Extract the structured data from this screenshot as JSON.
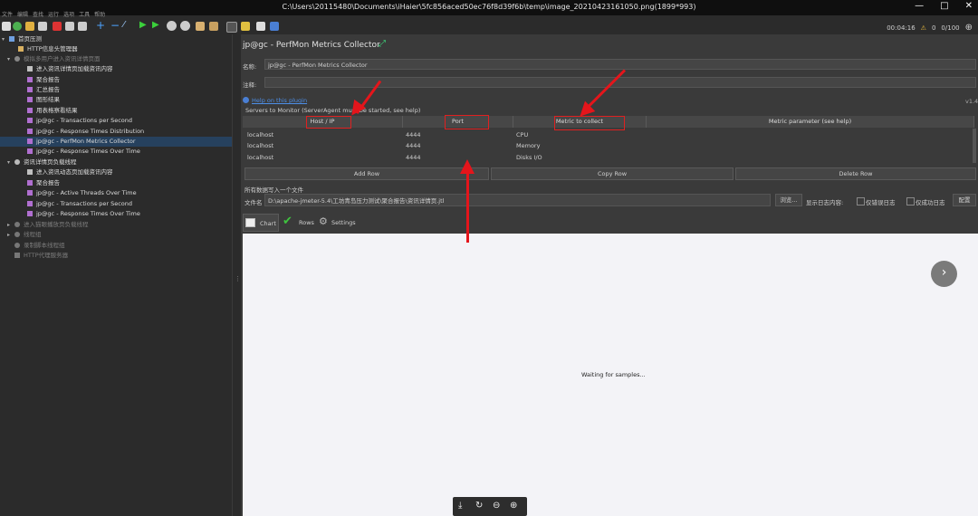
{
  "window": {
    "title": "C:\\Users\\20115480\\Documents\\iHaier\\5fc856aced50ec76f8d39f6b\\temp\\image_20210423161050.png(1899*993)"
  },
  "menu": {
    "items": [
      "文件",
      "编辑",
      "查找",
      "运行",
      "选项",
      "工具",
      "帮助"
    ]
  },
  "toolbar": {
    "timer": "00:04:16",
    "warn_count": "0",
    "thread_count": "0/100"
  },
  "tree": {
    "items": [
      {
        "label": "首页压测",
        "dim": false
      },
      {
        "label": "HTTP信息头管理器",
        "dim": false
      },
      {
        "label": "模拟多用户进入资讯详情页面",
        "dim": true
      },
      {
        "label": "进入资讯详情页加载资讯内容",
        "dim": false
      },
      {
        "label": "聚合报告",
        "dim": false
      },
      {
        "label": "汇总报告",
        "dim": false
      },
      {
        "label": "图形结果",
        "dim": false
      },
      {
        "label": "用表格察看结果",
        "dim": false
      },
      {
        "label": "jp@gc - Transactions per Second",
        "dim": false
      },
      {
        "label": "jp@gc - Response Times Distribution",
        "dim": false
      },
      {
        "label": "jp@gc - PerfMon Metrics Collector",
        "dim": false
      },
      {
        "label": "jp@gc - Response Times Over Time",
        "dim": false
      },
      {
        "label": "资讯详情页负载线程",
        "dim": false
      },
      {
        "label": "进入资讯动态页加载资讯内容",
        "dim": false
      },
      {
        "label": "聚合报告",
        "dim": false
      },
      {
        "label": "jp@gc - Active Threads Over Time",
        "dim": false
      },
      {
        "label": "jp@gc - Transactions per Second",
        "dim": false
      },
      {
        "label": "jp@gc - Response Times Over Time",
        "dim": false
      },
      {
        "label": "进入猫眼播放页负载线程",
        "dim": true
      },
      {
        "label": "线程组",
        "dim": true
      },
      {
        "label": "录制脚本线程组",
        "dim": true
      },
      {
        "label": "HTTP代理服务器",
        "dim": true
      }
    ]
  },
  "panel": {
    "title": "jp@gc - PerfMon Metrics Collector",
    "name_label": "名称:",
    "name_value": "jp@gc - PerfMon Metrics Collector",
    "comment_label": "注释:",
    "help_link": "Help on this plugin",
    "version": "v1.4",
    "servers_label": "Servers to Monitor (ServerAgent must be started, see help)",
    "columns": [
      "Host / IP",
      "Port",
      "Metric to collect",
      "Metric parameter (see help)"
    ],
    "rows": [
      [
        "localhost",
        "4444",
        "CPU",
        ""
      ],
      [
        "localhost",
        "4444",
        "Memory",
        ""
      ],
      [
        "localhost",
        "4444",
        "Disks I/O",
        ""
      ]
    ],
    "buttons": {
      "add_row": "Add Row",
      "copy_row": "Copy Row",
      "delete_row": "Delete Row"
    },
    "write_all_label": "所有数据写入一个文件",
    "file_label": "文件名",
    "file_value": "D:\\apache-jmeter-5.4\\工坊青岛压力测试\\聚合报告\\资讯详情页.jtl",
    "browse_button": "浏览...",
    "log_label": "显示日志内容:",
    "errors_only": "仅错误日志",
    "success_only": "仅成功日志",
    "config_button": "配置",
    "tabs": [
      "Chart",
      "Rows",
      "Settings"
    ],
    "waiting": "Waiting for samples..."
  },
  "colors": {
    "annotation": "#e4151b",
    "selection": "#26415e"
  }
}
